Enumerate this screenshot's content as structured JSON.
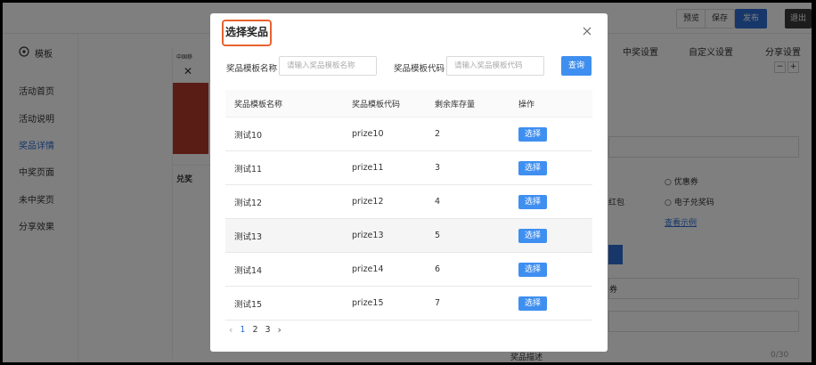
{
  "toolbar": {
    "preview_label": "预览",
    "save_label": "保存",
    "publish_label": "发布",
    "exit_label": "退出"
  },
  "sidebar": {
    "logo_label": "模板",
    "items": [
      {
        "label": "活动首页"
      },
      {
        "label": "活动说明"
      },
      {
        "label": "奖品详情",
        "active": true
      },
      {
        "label": "中奖页面"
      },
      {
        "label": "未中奖页"
      },
      {
        "label": "分享效果"
      }
    ]
  },
  "background": {
    "tabs": [
      "中奖设置",
      "自定义设置",
      "分享设置"
    ],
    "coupon_label": "优惠券",
    "ecode_label": "电子兑奖码",
    "red_label": "红包",
    "example_link": "查看示例",
    "desc_label": "奖品描述",
    "counter": "0/30",
    "carrier": "中国移",
    "exchange_label": "兑奖",
    "coupon_btn": "券"
  },
  "modal": {
    "title": "选择奖品",
    "name_label": "奖品模板名称",
    "name_placeholder": "请输入奖品模板名称",
    "code_label": "奖品模板代码",
    "code_placeholder": "请输入奖品模板代码",
    "query_label": "查询",
    "columns": [
      "奖品模板名称",
      "奖品模板代码",
      "剩余库存量",
      "操作"
    ],
    "rows": [
      {
        "name": "测试10",
        "code": "prize10",
        "stock": "2",
        "action": "选择"
      },
      {
        "name": "测试11",
        "code": "prize11",
        "stock": "3",
        "action": "选择"
      },
      {
        "name": "测试12",
        "code": "prize12",
        "stock": "4",
        "action": "选择"
      },
      {
        "name": "测试13",
        "code": "prize13",
        "stock": "5",
        "action": "选择"
      },
      {
        "name": "测试14",
        "code": "prize14",
        "stock": "6",
        "action": "选择"
      },
      {
        "name": "测试15",
        "code": "prize15",
        "stock": "7",
        "action": "选择"
      }
    ],
    "pagination": {
      "pages": [
        "1",
        "2",
        "3"
      ],
      "current": "1"
    }
  },
  "colors": {
    "accent": "#3f8ff0",
    "highlight": "#e8622f",
    "brand": "#2e6fd6"
  }
}
